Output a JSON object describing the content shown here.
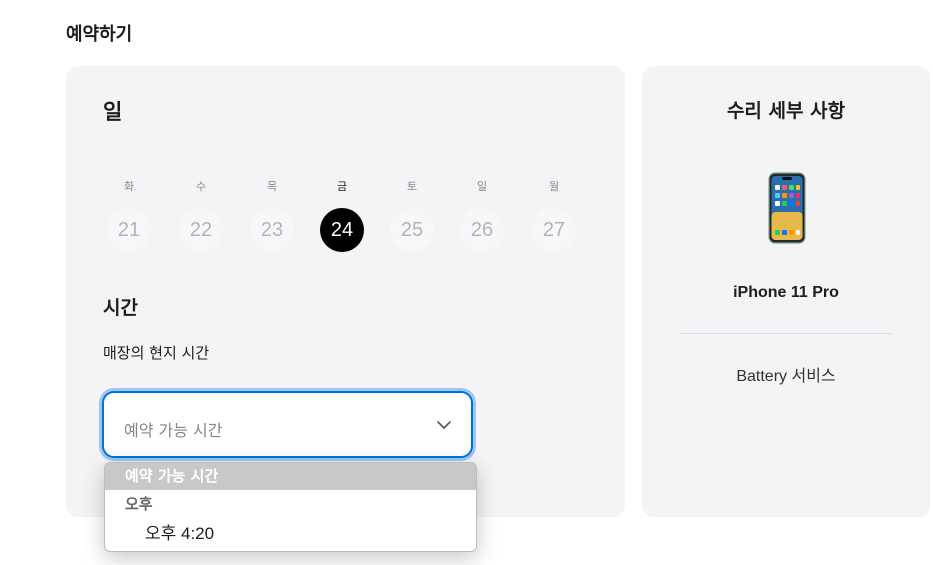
{
  "page": {
    "title": "예약하기"
  },
  "booking": {
    "day_heading": "일",
    "days": [
      {
        "weekday": "화",
        "date": "21",
        "selected": false
      },
      {
        "weekday": "수",
        "date": "22",
        "selected": false
      },
      {
        "weekday": "목",
        "date": "23",
        "selected": false
      },
      {
        "weekday": "금",
        "date": "24",
        "selected": true
      },
      {
        "weekday": "토",
        "date": "25",
        "selected": false
      },
      {
        "weekday": "일",
        "date": "26",
        "selected": false
      },
      {
        "weekday": "월",
        "date": "27",
        "selected": false
      }
    ],
    "time_heading": "시간",
    "time_subtitle": "매장의 현지 시간",
    "time_select": {
      "value": "예약 가능 시간",
      "icon": "chevron-down-icon"
    },
    "dropdown": {
      "header": "예약 가능 시간",
      "group_label": "오후",
      "options": [
        "오후 4:20"
      ]
    }
  },
  "summary": {
    "title": "수리 세부 사항",
    "device_icon": "iphone-icon",
    "device_name": "iPhone 11 Pro",
    "service": "Battery 서비스"
  },
  "colors": {
    "accent": "#0071e3",
    "selected_day": "#000000",
    "card_bg": "#f4f4f6"
  }
}
